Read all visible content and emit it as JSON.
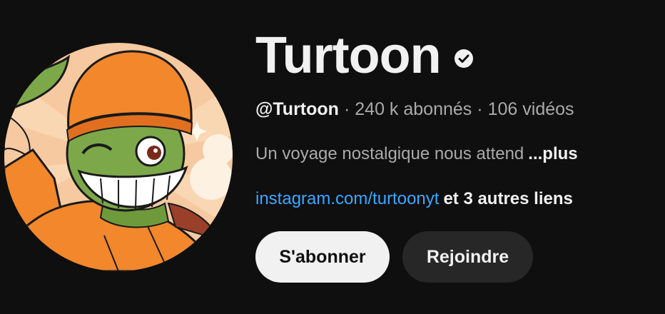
{
  "channel": {
    "name": "Turtoon",
    "verified_icon": "verified-check-icon",
    "handle": "@Turtoon",
    "subscribers": "240 k abonnés",
    "videos": "106 vidéos",
    "separator": "·",
    "description": "Un voyage nostalgique nous attend",
    "more_label": "...plus",
    "link_text": "instagram.com/turtoonyt",
    "other_links": "et 3 autres liens"
  },
  "actions": {
    "subscribe_label": "S'abonner",
    "join_label": "Rejoindre"
  },
  "colors": {
    "background": "#0f0f0f",
    "text_primary": "#f1f1f1",
    "text_secondary": "#aaaaaa",
    "link": "#3ea6ff",
    "subscribe_bg": "#f1f1f1",
    "join_bg": "#272727"
  }
}
